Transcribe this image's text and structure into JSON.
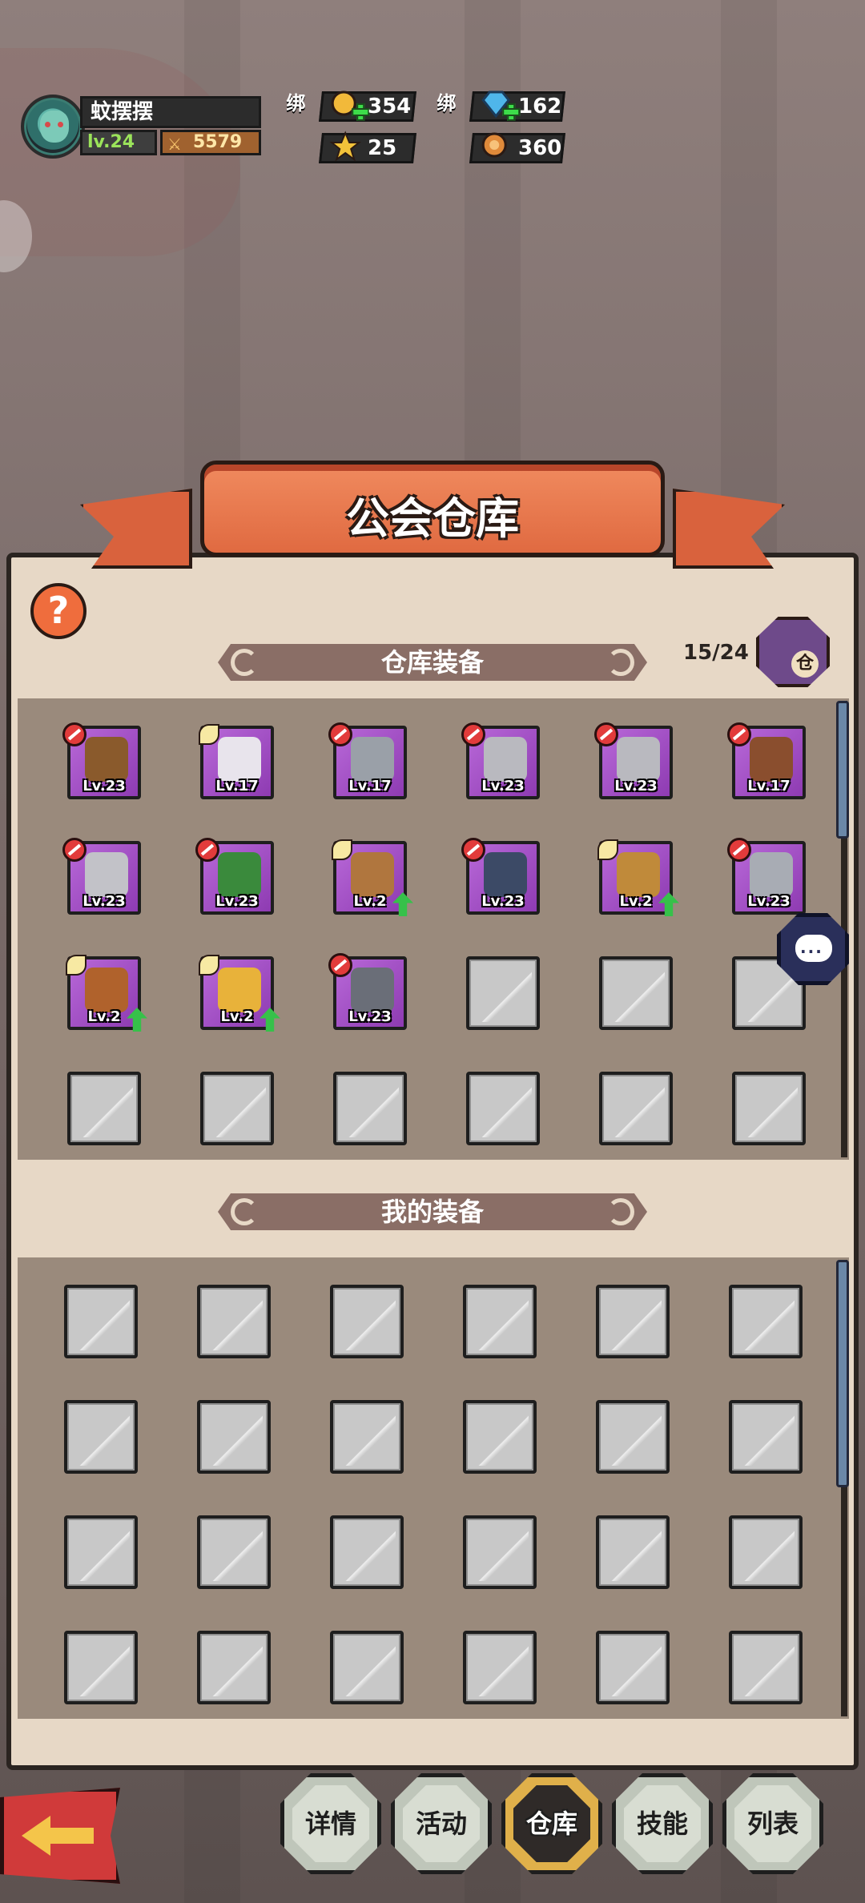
{
  "player": {
    "name": "蚊摆摆",
    "level_label": "lv.24",
    "power": "5579"
  },
  "resources": {
    "bind_label": "绑",
    "bound_gold": "354",
    "bound_gems": "162",
    "stars": "25",
    "tokens": "360"
  },
  "title": "公会仓库",
  "help_label": "?",
  "warehouse": {
    "section_label": "仓库装备",
    "capacity": "15/24",
    "chest_label": "仓",
    "items": [
      {
        "level": "Lv.23",
        "badge": "ban",
        "upgrade": false,
        "art": "hood",
        "color": "#8a5a2c"
      },
      {
        "level": "Lv.17",
        "badge": "new",
        "upgrade": false,
        "art": "blade",
        "color": "#e8e4ec"
      },
      {
        "level": "Lv.17",
        "badge": "ban",
        "upgrade": false,
        "art": "shield",
        "color": "#9aa0a8"
      },
      {
        "level": "Lv.23",
        "badge": "ban",
        "upgrade": false,
        "art": "boots",
        "color": "#b9b9bf"
      },
      {
        "level": "Lv.23",
        "badge": "ban",
        "upgrade": false,
        "art": "boots",
        "color": "#b9b9bf"
      },
      {
        "level": "Lv.17",
        "badge": "ban",
        "upgrade": false,
        "art": "boots",
        "color": "#8a4e2e"
      },
      {
        "level": "Lv.23",
        "badge": "ban",
        "upgrade": false,
        "art": "greaves",
        "color": "#c2c2c8"
      },
      {
        "level": "Lv.23",
        "badge": "ban",
        "upgrade": false,
        "art": "pants",
        "color": "#3a8a3c"
      },
      {
        "level": "Lv.2",
        "badge": "new",
        "upgrade": true,
        "art": "pants",
        "color": "#b0763e"
      },
      {
        "level": "Lv.23",
        "badge": "ban",
        "upgrade": false,
        "art": "shorts",
        "color": "#3c4a66"
      },
      {
        "level": "Lv.2",
        "badge": "new",
        "upgrade": true,
        "art": "pants",
        "color": "#c08a3a"
      },
      {
        "level": "Lv.23",
        "badge": "ban",
        "upgrade": false,
        "art": "gauntlet",
        "color": "#a8acb4"
      },
      {
        "level": "Lv.2",
        "badge": "new",
        "upgrade": true,
        "art": "belt",
        "color": "#b0622c"
      },
      {
        "level": "Lv.2",
        "badge": "new",
        "upgrade": true,
        "art": "amulet",
        "color": "#e8b23a"
      },
      {
        "level": "Lv.23",
        "badge": "ban",
        "upgrade": false,
        "art": "belt",
        "color": "#6a6e78"
      }
    ]
  },
  "my_equipment": {
    "section_label": "我的装备"
  },
  "chat_label": "...",
  "nav": [
    {
      "label": "详情",
      "active": false
    },
    {
      "label": "活动",
      "active": false
    },
    {
      "label": "仓库",
      "active": true
    },
    {
      "label": "技能",
      "active": false
    },
    {
      "label": "列表",
      "active": false
    }
  ]
}
